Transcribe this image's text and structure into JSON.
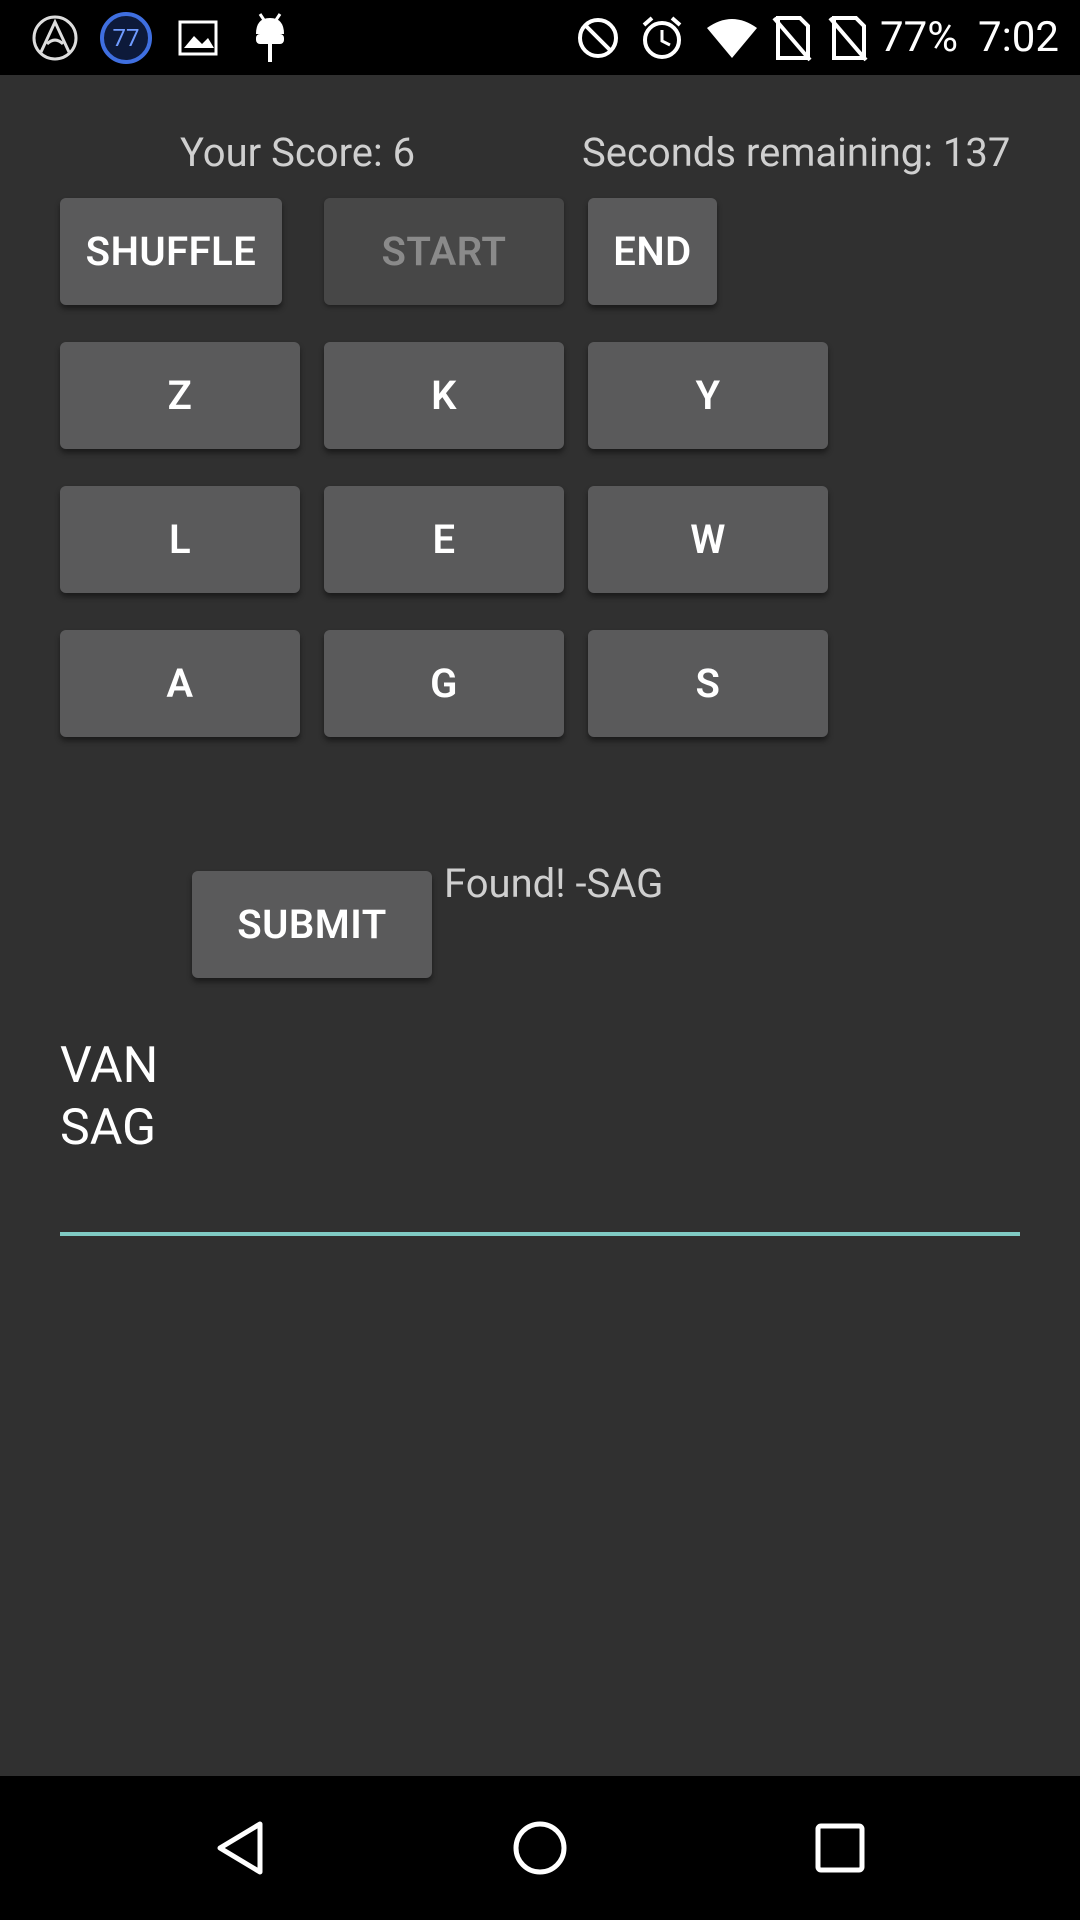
{
  "status_bar": {
    "icons_left": [
      "arch-logo-icon",
      "notification-badge-icon",
      "image-icon",
      "android-debug-icon"
    ],
    "badge_count": "77",
    "icons_right": [
      "do-not-disturb-icon",
      "alarm-icon",
      "wifi-icon",
      "no-sim-icon",
      "no-sim-icon"
    ],
    "battery": "77%",
    "time": "7:02"
  },
  "game": {
    "score_label": "Your Score: 6",
    "timer_label": "Seconds remaining: 137",
    "controls": {
      "shuffle": "SHUFFLE",
      "start": "START",
      "end": "END"
    },
    "letters": [
      "Z",
      "K",
      "Y",
      "L",
      "E",
      "W",
      "A",
      "G",
      "S"
    ],
    "submit": "SUBMIT",
    "message": "Found! -SAG",
    "found_words": [
      "VAN",
      "SAG"
    ]
  },
  "nav_bar": {
    "buttons": [
      "back-icon",
      "home-icon",
      "recents-icon"
    ]
  }
}
